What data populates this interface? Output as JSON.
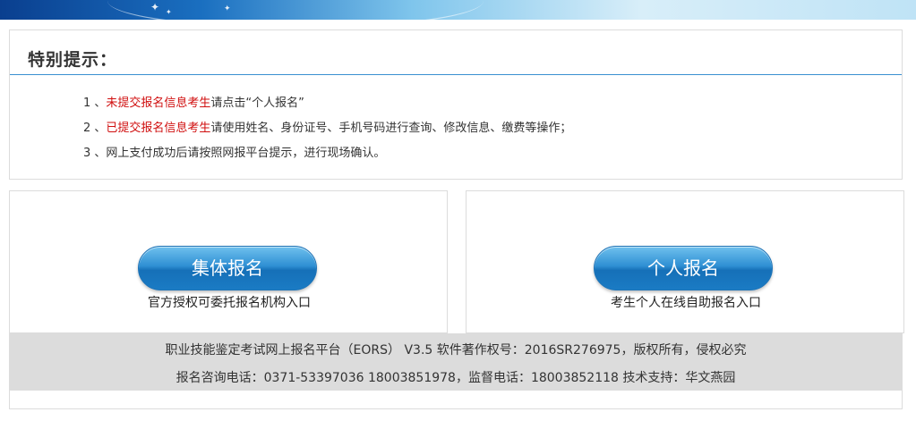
{
  "notice": {
    "title": "特别提示：",
    "items": [
      {
        "prefix": "1 、",
        "red": "未提交报名信息考生",
        "rest": "请点击“个人报名”"
      },
      {
        "prefix": "2 、",
        "red": "已提交报名信息考生",
        "rest": "请使用姓名、身份证号、手机号码进行查询、修改信息、缴费等操作；"
      },
      {
        "prefix": "3 、",
        "red": "",
        "rest": "网上支付成功后请按照网报平台提示，进行现场确认。"
      }
    ]
  },
  "group_panel": {
    "button_label": "集体报名",
    "caption": "官方授权可委托报名机构入口"
  },
  "individual_panel": {
    "button_label": "个人报名",
    "caption": "考生个人在线自助报名入口"
  },
  "footer": {
    "line1": "职业技能鉴定考试网上报名平台（EORS） V3.5 软件著作权号：2016SR276975，版权所有，侵权必究",
    "line2": "报名咨询电话：0371-53397036 18003851978，监督电话：18003852118  技术支持：华文燕园"
  },
  "colors": {
    "accent_blue": "#1a7bc4",
    "highlight_red": "#d00f0f",
    "footer_gray": "#dcdcdc"
  }
}
